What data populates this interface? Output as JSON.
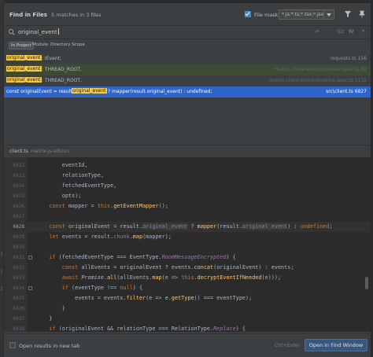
{
  "header": {
    "title": "Find in Files",
    "match_summary": "5 matches in 3 files",
    "file_mask_label": "File mask:",
    "file_mask_value": "*.js;*.ts;*.tsx;*.jsx",
    "file_mask_checked": true
  },
  "search": {
    "query": "original_event",
    "options": [
      "A-Z",
      "Cc",
      "W",
      ".*"
    ]
  },
  "scope_tabs": [
    "In Project",
    "Module",
    "Directory",
    "Scope"
  ],
  "active_scope": "In Project",
  "results": [
    {
      "match": "original_event",
      "text": ": IEvent;",
      "location": "requests.ts 156"
    },
    {
      "match": "original_event",
      "text": ": THREAD_ROOT,",
      "location": "matrix-client-event-timeline.spec.ts 89"
    },
    {
      "match": "original_event",
      "text": ": THREAD_ROOT,",
      "location": "matrix-client-event-timeline.spec.ts 1132"
    },
    {
      "prefix": "const originalEvent = result.",
      "match": "original_event",
      "text": " ? mapper(result.original_event) : undefined;",
      "location": "src\\client.ts 6827"
    }
  ],
  "preview": {
    "file": "client.ts",
    "path": "matrix-js-sdk/src"
  },
  "code_lines": [
    {
      "n": "6822"
    },
    {
      "n": "6823"
    },
    {
      "n": "6824"
    },
    {
      "n": "6825"
    },
    {
      "n": "6826"
    },
    {
      "n": "6827"
    },
    {
      "n": "6828"
    },
    {
      "n": "6829"
    },
    {
      "n": "6830"
    },
    {
      "n": "6831"
    },
    {
      "n": "6832"
    },
    {
      "n": "6833"
    },
    {
      "n": "6834"
    },
    {
      "n": "6835"
    },
    {
      "n": "6836"
    },
    {
      "n": "6837"
    },
    {
      "n": "6838"
    }
  ],
  "footer": {
    "new_tab_label": "Open results in new tab",
    "shortcut": "Ctrl+Enter",
    "open_button": "Open in Find Window"
  },
  "bg_gutter_numbers": [
    "3",
    "3",
    "3"
  ]
}
